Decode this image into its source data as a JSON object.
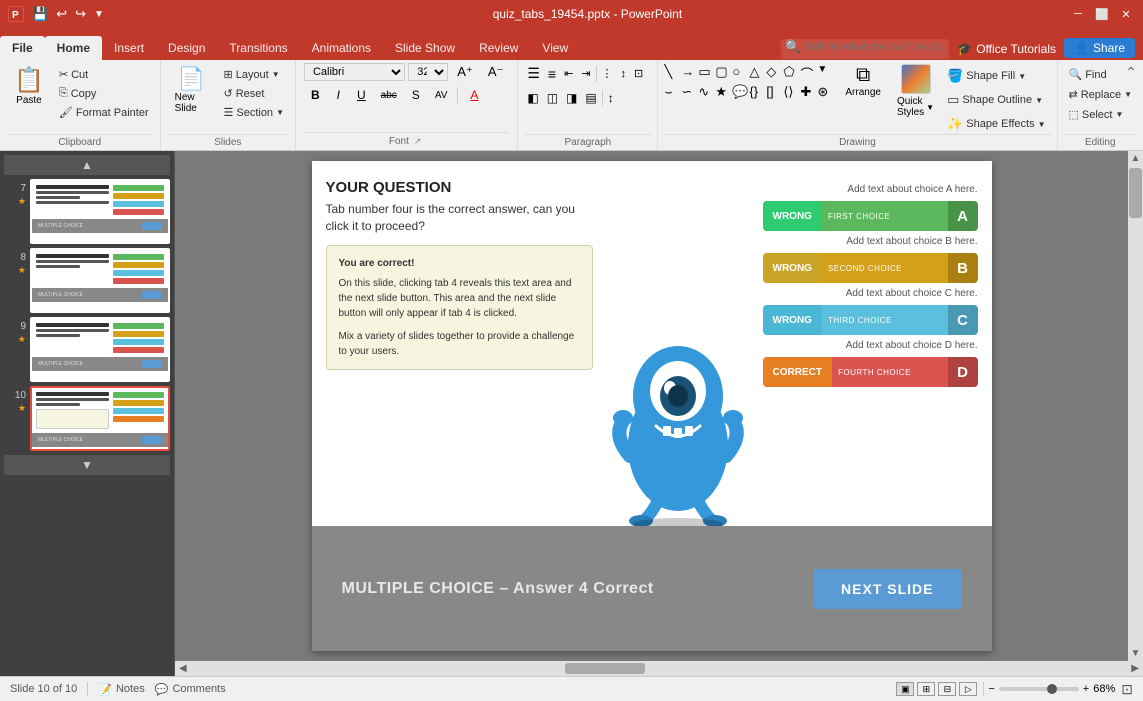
{
  "window": {
    "title": "quiz_tabs_19454.pptx - PowerPoint",
    "controls": [
      "minimize",
      "restore",
      "close"
    ],
    "quickAccess": [
      "save",
      "undo",
      "redo",
      "customize"
    ]
  },
  "ribbon": {
    "tabs": [
      {
        "id": "file",
        "label": "File"
      },
      {
        "id": "home",
        "label": "Home",
        "active": true
      },
      {
        "id": "insert",
        "label": "Insert"
      },
      {
        "id": "design",
        "label": "Design"
      },
      {
        "id": "transitions",
        "label": "Transitions"
      },
      {
        "id": "animations",
        "label": "Animations"
      },
      {
        "id": "slideshow",
        "label": "Slide Show"
      },
      {
        "id": "review",
        "label": "Review"
      },
      {
        "id": "view",
        "label": "View"
      }
    ],
    "tell": "Tell me what you want to do...",
    "officeTutorials": "Office Tutorials",
    "share": "Share",
    "groups": {
      "clipboard": {
        "label": "Clipboard",
        "paste": "Paste",
        "cut": "Cut",
        "copy": "Copy",
        "formatPainter": "Format Painter"
      },
      "slides": {
        "label": "Slides",
        "newSlide": "New Slide",
        "layout": "Layout",
        "reset": "Reset",
        "section": "Section"
      },
      "font": {
        "label": "Font",
        "fontFace": "Calibri",
        "fontSize": "32",
        "bold": "B",
        "italic": "I",
        "underline": "U",
        "strikethrough": "abc",
        "shadowBtn": "S",
        "charSpacing": "AV",
        "fontColor": "A",
        "changeFontSize": [
          "A+",
          "A-"
        ]
      },
      "paragraph": {
        "label": "Paragraph"
      },
      "drawing": {
        "label": "Drawing",
        "arrange": "Arrange",
        "quickStyles": "Quick Styles",
        "shapeFill": "Shape Fill",
        "shapeOutline": "Shape Outline",
        "shapeEffects": "Shape Effects"
      },
      "editing": {
        "label": "Editing",
        "find": "Find",
        "replace": "Replace",
        "select": "Select"
      }
    }
  },
  "slidePanel": {
    "slides": [
      {
        "num": 7,
        "star": true,
        "active": false
      },
      {
        "num": 8,
        "star": true,
        "active": false
      },
      {
        "num": 9,
        "star": true,
        "active": false
      },
      {
        "num": 10,
        "star": true,
        "active": true
      }
    ]
  },
  "slide": {
    "question": {
      "title": "YOUR QUESTION",
      "text": "Tab number four is the correct answer, can you click it to proceed?"
    },
    "answerBox": {
      "title": "You are correct!",
      "body": "On this slide, clicking tab 4 reveals this text area and the next slide button. This area and the next slide button will only appear if tab 4 is clicked.\n\nMix a variety of slides together to provide a challenge to your users."
    },
    "choices": [
      {
        "status": "WRONG",
        "name": "FIRST CHOICE",
        "letter": "A",
        "hint": "Add text about choice A here.",
        "class": "choice-a",
        "statusClass": "wrong"
      },
      {
        "status": "WRONG",
        "name": "SECOND CHOICE",
        "letter": "B",
        "hint": "Add text about choice B here.",
        "class": "choice-b",
        "statusClass": "wrong"
      },
      {
        "status": "WRONG",
        "name": "THIRD CHOICE",
        "letter": "C",
        "hint": "Add text about choice C here.",
        "class": "choice-c",
        "statusClass": "wrong"
      },
      {
        "status": "CORRECT",
        "name": "FOURTH CHOICE",
        "letter": "D",
        "hint": "Add text about choice D here.",
        "class": "choice-d",
        "statusClass": "correct"
      }
    ],
    "footer": {
      "title": "MULTIPLE CHOICE – Answer 4 Correct",
      "nextSlide": "NEXT SLIDE"
    }
  },
  "statusBar": {
    "slideInfo": "Slide 10 of 10",
    "notes": "Notes",
    "comments": "Comments",
    "zoom": "68%"
  }
}
